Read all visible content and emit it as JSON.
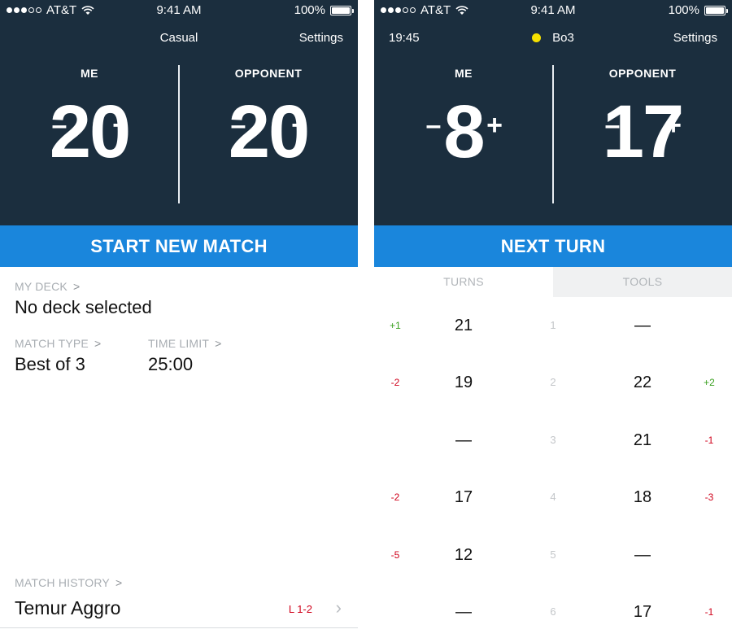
{
  "colors": {
    "header_bg": "#1b2e3e",
    "accent": "#1a86dc",
    "gain": "#3aa020",
    "loss": "#d0021b",
    "indicator": "#f5e000"
  },
  "status_bar": {
    "carrier": "AT&T",
    "time": "9:41 AM",
    "battery": "100%",
    "signal_dots": 5,
    "signal_filled": 3
  },
  "left": {
    "nav": {
      "title": "Casual",
      "settings": "Settings"
    },
    "players": {
      "me": {
        "label": "ME",
        "life": "20"
      },
      "opponent": {
        "label": "OPPONENT",
        "life": "20"
      }
    },
    "controls": {
      "minus": "–",
      "plus": "+"
    },
    "action": "START NEW MATCH",
    "deck": {
      "label": "MY DECK",
      "chevron": ">",
      "value": "No deck selected"
    },
    "match_type": {
      "label": "MATCH TYPE",
      "chevron": ">",
      "value": "Best of 3"
    },
    "time_limit": {
      "label": "TIME LIMIT",
      "chevron": ">",
      "value": "25:00"
    },
    "history": {
      "label": "MATCH HISTORY",
      "chevron": ">",
      "item": {
        "name": "Temur Aggro",
        "result": "L 1-2",
        "chevron": "›"
      }
    }
  },
  "right": {
    "nav": {
      "timer": "19:45",
      "format": "Bo3",
      "settings": "Settings"
    },
    "players": {
      "me": {
        "label": "ME",
        "life": "8"
      },
      "opponent": {
        "label": "OPPONENT",
        "life": "17"
      }
    },
    "controls": {
      "minus": "–",
      "plus": "+"
    },
    "action": "NEXT TURN",
    "tabs": {
      "turns": "TURNS",
      "tools": "TOOLS"
    },
    "turns": [
      {
        "num": "1",
        "me_delta": "+1",
        "me_life": "21",
        "opp_life": "—",
        "opp_delta": ""
      },
      {
        "num": "2",
        "me_delta": "-2",
        "me_life": "19",
        "opp_life": "22",
        "opp_delta": "+2"
      },
      {
        "num": "3",
        "me_delta": "",
        "me_life": "—",
        "opp_life": "21",
        "opp_delta": "-1"
      },
      {
        "num": "4",
        "me_delta": "-2",
        "me_life": "17",
        "opp_life": "18",
        "opp_delta": "-3"
      },
      {
        "num": "5",
        "me_delta": "-5",
        "me_life": "12",
        "opp_life": "—",
        "opp_delta": ""
      },
      {
        "num": "6",
        "me_delta": "",
        "me_life": "—",
        "opp_life": "17",
        "opp_delta": "-1"
      }
    ]
  }
}
